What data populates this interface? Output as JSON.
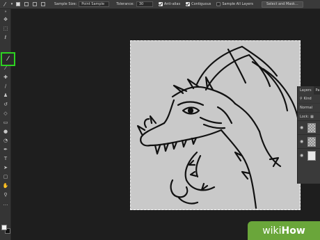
{
  "options_bar": {
    "sample_size_label": "Sample Size:",
    "sample_size_value": "Point Sample",
    "tolerance_label": "Tolerance:",
    "tolerance_value": "30",
    "anti_alias_label": "Anti-alias",
    "contiguous_label": "Contiguous",
    "sample_all_layers_label": "Sample All Layers",
    "select_mask_button": "Select and Mask...",
    "checkbox_states": {
      "anti_alias": true,
      "contiguous": true,
      "sample_all_layers": false
    }
  },
  "toolbar": {
    "tools": [
      "move-icon",
      "marquee-icon",
      "lasso-icon",
      "magic-wand-icon",
      "crop-icon",
      "eyedropper-icon",
      "healing-icon",
      "brush-icon",
      "stamp-icon",
      "history-brush-icon",
      "eraser-icon",
      "gradient-icon",
      "blur-icon",
      "dodge-icon",
      "pen-icon",
      "type-icon",
      "path-select-icon",
      "shape-icon",
      "hand-icon",
      "zoom-icon",
      "more-icon"
    ],
    "highlight_color": "#2dd321",
    "active_tool": "magic-wand-icon"
  },
  "layers_panel": {
    "tab_layers": "Layers",
    "tab_paths": "Pa",
    "kind_label": "Kind",
    "blend_mode": "Normal",
    "lock_label": "Lock:",
    "layers": [
      {
        "thumb": "checker"
      },
      {
        "thumb": "checker"
      },
      {
        "thumb": "white"
      }
    ]
  },
  "watermark": {
    "prefix": "wiki",
    "suffix": "How",
    "color": "#6aa63a"
  }
}
